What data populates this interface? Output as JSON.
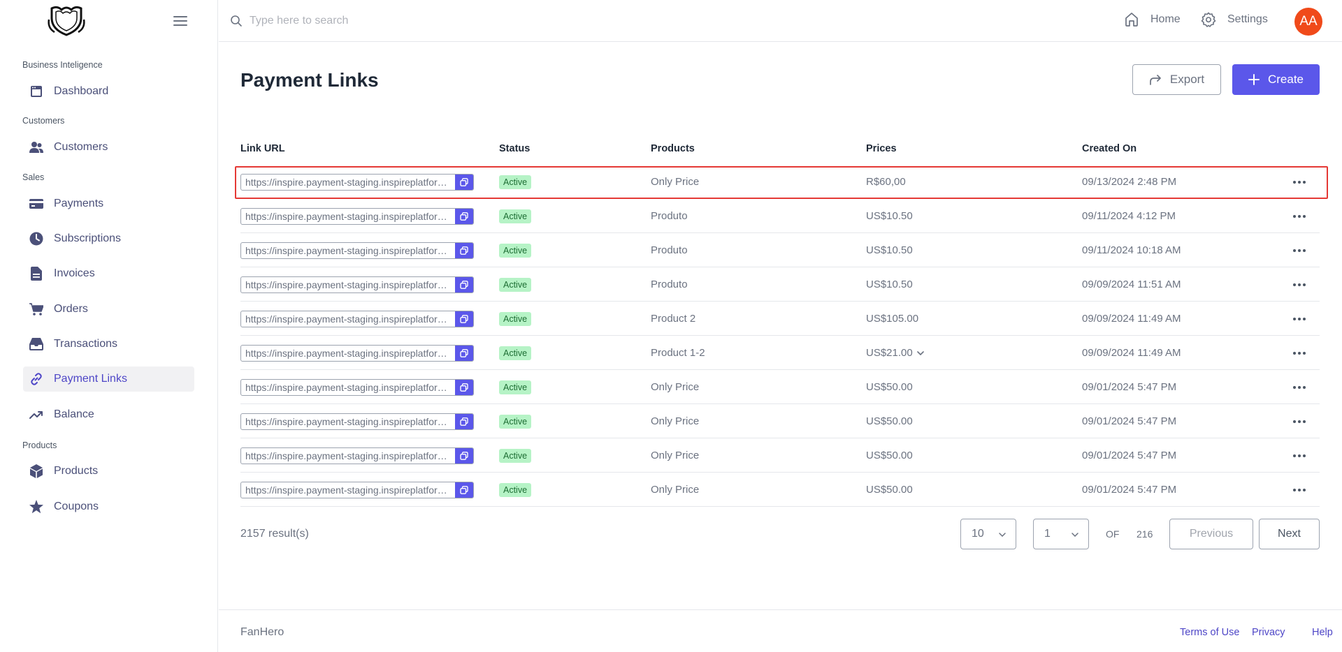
{
  "sidebar": {
    "sections": [
      {
        "label": "Business Inteligence"
      },
      {
        "label": "Customers"
      },
      {
        "label": "Sales"
      },
      {
        "label": "Products"
      }
    ],
    "items": [
      {
        "label": "Dashboard",
        "icon": "dashboard-icon"
      },
      {
        "label": "Customers",
        "icon": "users-icon"
      },
      {
        "label": "Payments",
        "icon": "credit-card-icon"
      },
      {
        "label": "Subscriptions",
        "icon": "clock-icon"
      },
      {
        "label": "Invoices",
        "icon": "document-icon"
      },
      {
        "label": "Orders",
        "icon": "cart-icon"
      },
      {
        "label": "Transactions",
        "icon": "inbox-icon"
      },
      {
        "label": "Payment Links",
        "icon": "link-icon",
        "active": true
      },
      {
        "label": "Balance",
        "icon": "trending-up-icon"
      },
      {
        "label": "Products",
        "icon": "cube-icon"
      },
      {
        "label": "Coupons",
        "icon": "star-icon"
      }
    ]
  },
  "topbar": {
    "search_placeholder": "Type here to search",
    "home_label": "Home",
    "settings_label": "Settings",
    "avatar_initials": "AA"
  },
  "page": {
    "title": "Payment Links",
    "export_label": "Export",
    "create_label": "Create"
  },
  "table": {
    "headers": {
      "link_url": "Link URL",
      "status": "Status",
      "products": "Products",
      "prices": "Prices",
      "created_on": "Created On"
    },
    "rows": [
      {
        "url": "https://inspire.payment-staging.inspireplatform.com/",
        "status": "Active",
        "product": "Only Price",
        "price": "R$60,00",
        "created": "09/13/2024 2:48 PM"
      },
      {
        "url": "https://inspire.payment-staging.inspireplatform.com/",
        "status": "Active",
        "product": "Produto",
        "price": "US$10.50",
        "created": "09/11/2024 4:12 PM"
      },
      {
        "url": "https://inspire.payment-staging.inspireplatform.com/",
        "status": "Active",
        "product": "Produto",
        "price": "US$10.50",
        "created": "09/11/2024 10:18 AM"
      },
      {
        "url": "https://inspire.payment-staging.inspireplatform.com/",
        "status": "Active",
        "product": "Produto",
        "price": "US$10.50",
        "created": "09/09/2024 11:51 AM"
      },
      {
        "url": "https://inspire.payment-staging.inspireplatform.com/",
        "status": "Active",
        "product": "Product 2",
        "price": "US$105.00",
        "created": "09/09/2024 11:49 AM"
      },
      {
        "url": "https://inspire.payment-staging.inspireplatform.com/",
        "status": "Active",
        "product": "Product 1-2",
        "price": "US$21.00",
        "price_expandable": true,
        "created": "09/09/2024 11:49 AM"
      },
      {
        "url": "https://inspire.payment-staging.inspireplatform.com/",
        "status": "Active",
        "product": "Only Price",
        "price": "US$50.00",
        "created": "09/01/2024 5:47 PM"
      },
      {
        "url": "https://inspire.payment-staging.inspireplatform.com/",
        "status": "Active",
        "product": "Only Price",
        "price": "US$50.00",
        "created": "09/01/2024 5:47 PM"
      },
      {
        "url": "https://inspire.payment-staging.inspireplatform.com/",
        "status": "Active",
        "product": "Only Price",
        "price": "US$50.00",
        "created": "09/01/2024 5:47 PM"
      },
      {
        "url": "https://inspire.payment-staging.inspireplatform.com/",
        "status": "Active",
        "product": "Only Price",
        "price": "US$50.00",
        "created": "09/01/2024 5:47 PM"
      }
    ]
  },
  "pagination": {
    "results_label": "2157 result(s)",
    "page_size": "10",
    "current_page": "1",
    "of_label": "OF",
    "total_pages": "216",
    "previous_label": "Previous",
    "next_label": "Next"
  },
  "footer": {
    "brand": "FanHero",
    "terms_label": "Terms of Use",
    "privacy_label": "Privacy",
    "help_label": "Help"
  },
  "colors": {
    "accent": "#5b57ea",
    "active_badge_bg": "#b6f3c6",
    "avatar_bg": "#f04a1a",
    "highlight_border": "#e53935"
  }
}
